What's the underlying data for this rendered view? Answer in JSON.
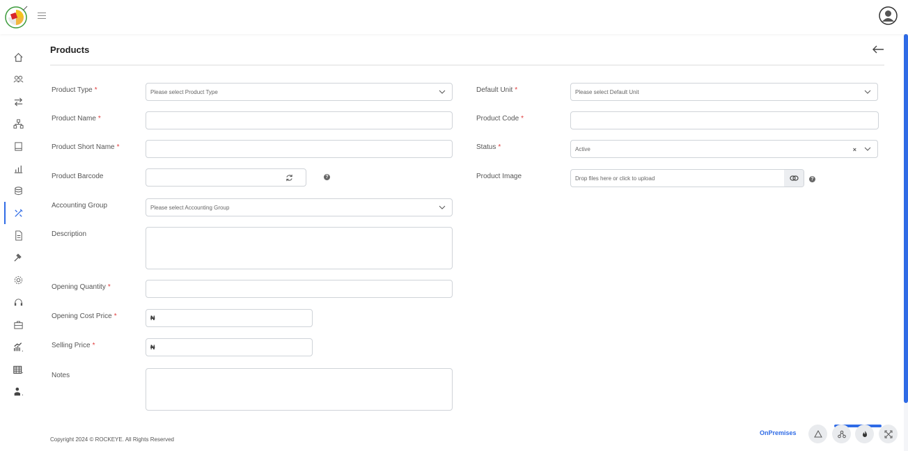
{
  "page": {
    "title": "Products"
  },
  "form": {
    "product_type": {
      "label": "Product Type",
      "placeholder": "Please select Product Type"
    },
    "product_name": {
      "label": "Product Name",
      "value": ""
    },
    "product_short_name": {
      "label": "Product Short Name",
      "value": ""
    },
    "product_barcode": {
      "label": "Product Barcode",
      "value": ""
    },
    "accounting_group": {
      "label": "Accounting Group",
      "placeholder": "Please select Accounting Group"
    },
    "description": {
      "label": "Description",
      "value": ""
    },
    "opening_quantity": {
      "label": "Opening Quantity",
      "value": ""
    },
    "opening_cost_price": {
      "label": "Opening Cost Price",
      "currency": "₦",
      "value": ""
    },
    "selling_price": {
      "label": "Selling Price",
      "currency": "₦",
      "value": ""
    },
    "notes": {
      "label": "Notes",
      "value": ""
    },
    "default_unit": {
      "label": "Default Unit",
      "placeholder": "Please select Default Unit"
    },
    "product_code": {
      "label": "Product Code",
      "value": ""
    },
    "status": {
      "label": "Status",
      "value": "Active",
      "clear": "×"
    },
    "product_image": {
      "label": "Product Image",
      "placeholder": "Drop files here or click to upload"
    },
    "required_marker": "*",
    "help_glyph": "?"
  },
  "footer": {
    "copyright": "Copyright 2024 © ROCKEYE. All Rights Reserved",
    "mode": "OnPremises"
  },
  "colors": {
    "accent": "#2f6be6",
    "required": "#e03b3b"
  }
}
